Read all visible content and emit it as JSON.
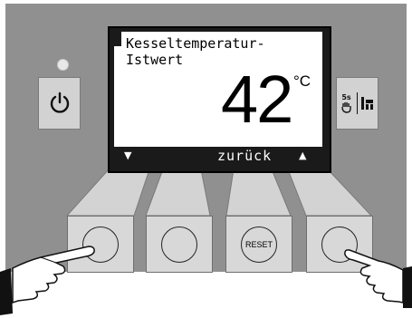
{
  "display": {
    "line1": "Kesseltemperatur-",
    "line2": "Istwert",
    "temperature": "42",
    "unit": "°C",
    "softkey_left": "▼",
    "softkey_middle": "zurück",
    "softkey_right": "▲"
  },
  "buttons": {
    "manual_label": "5s",
    "reset_label": "RESET"
  },
  "icons": {
    "power": "power-icon",
    "manual": "hand-5s-icon",
    "chimney": "chimney-sweep-icon"
  },
  "colors": {
    "panel": "#909090",
    "button_face": "#d2d2d2",
    "display_frame": "#1a1a1a",
    "screen": "#ffffff"
  }
}
